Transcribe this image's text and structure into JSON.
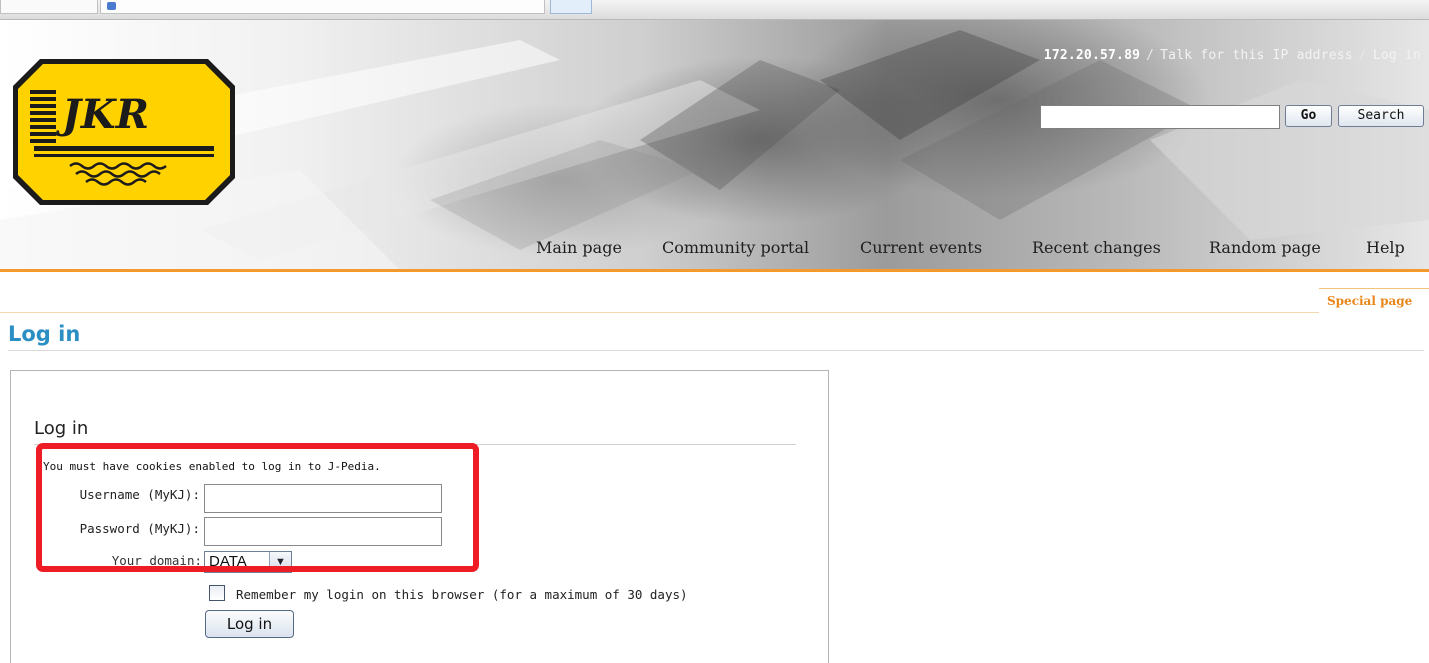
{
  "personal": {
    "ip": "172.20.57.89",
    "separator": "/",
    "talk_link": "Talk for this IP address",
    "login_link": "Log in"
  },
  "logo": {
    "text": "JKR"
  },
  "search": {
    "value": "",
    "go_label": "Go",
    "search_label": "Search"
  },
  "nav": {
    "items": [
      {
        "label": "Main page"
      },
      {
        "label": "Community portal"
      },
      {
        "label": "Current events"
      },
      {
        "label": "Recent changes"
      },
      {
        "label": "Random page"
      },
      {
        "label": "Help"
      }
    ]
  },
  "special_tab": "Special page",
  "page_title": "Log in",
  "login_form": {
    "legend": "Log in",
    "cookie_note": "You must have cookies enabled to log in to J-Pedia.",
    "username_label": "Username (MyKJ):",
    "username_value": "",
    "password_label": "Password (MyKJ):",
    "password_value": "",
    "domain_label": "Your domain:",
    "domain_value": "DATA",
    "remember_label": "Remember my login on this browser (for a maximum of 30 days)",
    "remember_checked": false,
    "submit_label": "Log in"
  },
  "colors": {
    "accent_orange": "#f39a2f",
    "title_blue": "#2b8fc4",
    "logo_yellow": "#ffd200",
    "highlight_red": "#ee1c24"
  }
}
